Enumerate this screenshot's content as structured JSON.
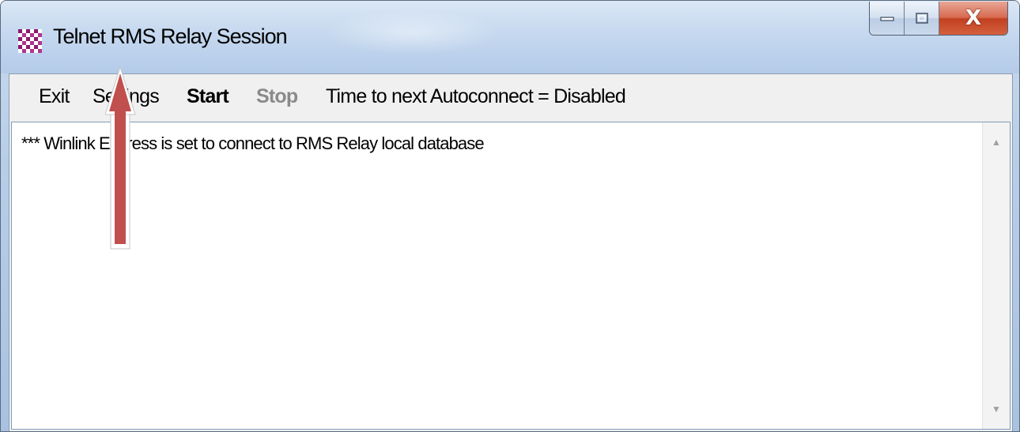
{
  "window": {
    "title": "Telnet RMS Relay Session",
    "close_glyph": "X",
    "icon": "app-checker-icon"
  },
  "menu": {
    "exit": "Exit",
    "settings": "Settings",
    "start": "Start",
    "stop": "Stop",
    "autoconnect_status": "Time to next Autoconnect = Disabled"
  },
  "log": {
    "lines": [
      "*** Winlink Express is set to connect to RMS Relay local database"
    ]
  },
  "scrollbar": {
    "up_icon": "triangle-up-icon",
    "down_icon": "triangle-down-icon"
  },
  "annotation": {
    "icon": "red-up-arrow-icon",
    "color": "#c0504d"
  },
  "colors": {
    "close_button": "#c7452a",
    "icon_purple": "#8b1a6b"
  }
}
